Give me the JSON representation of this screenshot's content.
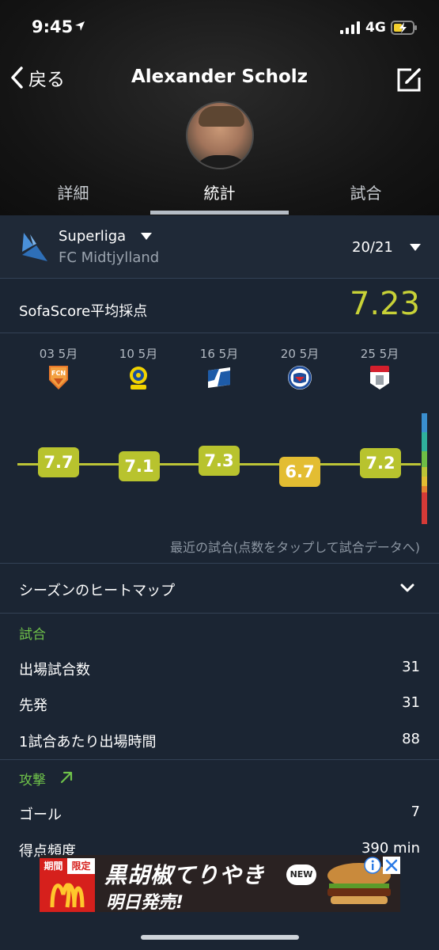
{
  "status_bar": {
    "time": "9:45",
    "network": "4G"
  },
  "nav": {
    "back_label": "戻る",
    "player_name": "Alexander Scholz"
  },
  "tabs": [
    {
      "label": "詳細",
      "active": false
    },
    {
      "label": "統計",
      "active": true
    },
    {
      "label": "試合",
      "active": false
    }
  ],
  "league": {
    "name": "Superliga",
    "team": "FC Midtjylland",
    "season": "20/21"
  },
  "average": {
    "label": "SofaScore平均採点",
    "value": "7.23"
  },
  "recent_matches": [
    {
      "date": "03 5月",
      "badge": "fc-nordsjaelland-badge-icon",
      "rating": "7.7",
      "color": "#b8c32e"
    },
    {
      "date": "10 5月",
      "badge": "brondby-badge-icon",
      "rating": "7.1",
      "color": "#b8c32e"
    },
    {
      "date": "16 5月",
      "badge": "randers-badge-icon",
      "rating": "7.3",
      "color": "#b8c32e"
    },
    {
      "date": "20 5月",
      "badge": "fc-kobenhavn-badge-icon",
      "rating": "6.7",
      "color": "#e3bd32"
    },
    {
      "date": "25 5月",
      "badge": "agf-badge-icon",
      "rating": "7.2",
      "color": "#b8c32e"
    }
  ],
  "chart_caption": "最近の試合(点数をタップして試合データへ)",
  "heatmap": {
    "label": "シーズンのヒートマップ"
  },
  "sections": {
    "matches": {
      "header": "試合",
      "rows": [
        {
          "label": "出場試合数",
          "value": "31"
        },
        {
          "label": "先発",
          "value": "31"
        },
        {
          "label": "1試合あたり出場時間",
          "value": "88"
        }
      ]
    },
    "attack": {
      "header": "攻撃",
      "rows": [
        {
          "label": "ゴール",
          "value": "7"
        },
        {
          "label": "得点頻度",
          "value": "390 min"
        }
      ]
    }
  },
  "ad": {
    "tag_left": "期間",
    "tag_right": "限定",
    "title": "黒胡椒てりやき",
    "subtitle": "明日発売!",
    "new_badge": "NEW"
  },
  "colors": {
    "accent_rating": "#c8d237",
    "section_green": "#6fc24a",
    "rating_good": "#b8c32e",
    "rating_avg": "#e3bd32",
    "background": "#1b2533"
  }
}
